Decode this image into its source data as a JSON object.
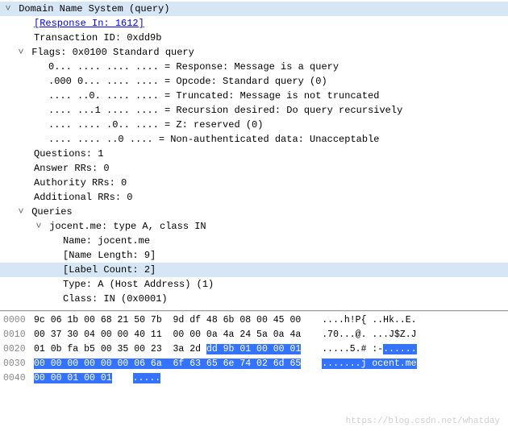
{
  "dns": {
    "title": "Domain Name System (query)",
    "response_in_label": "[Response In: 1612]",
    "transaction_id": "Transaction ID: 0xdd9b",
    "flags_summary": "Flags: 0x0100 Standard query",
    "flag_response": "0... .... .... .... = Response: Message is a query",
    "flag_opcode": ".000 0... .... .... = Opcode: Standard query (0)",
    "flag_truncated": ".... ..0. .... .... = Truncated: Message is not truncated",
    "flag_recursion": ".... ...1 .... .... = Recursion desired: Do query recursively",
    "flag_z": ".... .... .0.. .... = Z: reserved (0)",
    "flag_nonauth": ".... .... ..0 .... = Non-authenticated data: Unacceptable",
    "questions": "Questions: 1",
    "answer_rrs": "Answer RRs: 0",
    "authority_rrs": "Authority RRs: 0",
    "additional_rrs": "Additional RRs: 0",
    "queries_label": "Queries",
    "query_summary": "jocent.me: type A, class IN",
    "query_name": "Name: jocent.me",
    "query_name_len": "[Name Length: 9]",
    "query_label_count": "[Label Count: 2]",
    "query_type": "Type: A (Host Address) (1)",
    "query_class": "Class: IN (0x0001)"
  },
  "hex": {
    "rows": [
      {
        "offset": "0000",
        "b1": "9c 06 1b 00 68 21 50 7b  9d df 48 6b 08 00 45 00",
        "a1": "....h!P{ ..Hk..E."
      },
      {
        "offset": "0010",
        "b1": "00 37 30 04 00 00 40 11  00 00 0a 4a 24 5a 0a 4a",
        "a1": ".70...@. ...J$Z.J"
      },
      {
        "offset": "0020",
        "b1": "01 0b fa b5 00 35 00 23  3a 2d ",
        "b2": "dd 9b 01 00 00 01",
        "a1": ".....5.# :-",
        "a2": "......"
      },
      {
        "offset": "0030",
        "b2": "00 00 00 00 00 00 06 6a  6f 63 65 6e 74 02 6d 65",
        "a1": "",
        "a2": ".......j ocent.me"
      },
      {
        "offset": "0040",
        "b2": "00 00 01 00 01",
        "a1": "",
        "a2": "....."
      }
    ]
  },
  "watermark": "https://blog.csdn.net/whatday"
}
